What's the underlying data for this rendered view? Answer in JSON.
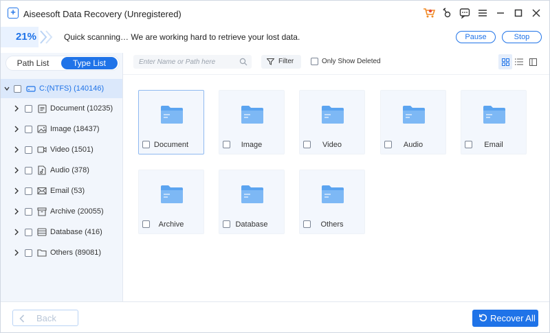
{
  "app": {
    "title": "Aiseesoft Data Recovery (Unregistered)"
  },
  "colors": {
    "accent": "#1f73e8",
    "selected_row": "#dbe8fb",
    "card_bg": "#f3f7fd",
    "folder": "#5ba4f0"
  },
  "progress": {
    "percent_label": "21%",
    "fraction": 0.21,
    "message": "Quick scanning… We are working hard to retrieve your lost data.",
    "pause_label": "Pause",
    "stop_label": "Stop"
  },
  "tabs": {
    "path_list": "Path List",
    "type_list": "Type List",
    "active": "type_list"
  },
  "tree": {
    "root": "C:(NTFS) (140146)",
    "items": [
      {
        "label": "Document (10235)",
        "icon": "document-icon"
      },
      {
        "label": "Image (18437)",
        "icon": "image-icon"
      },
      {
        "label": "Video (1501)",
        "icon": "video-icon"
      },
      {
        "label": "Audio (378)",
        "icon": "audio-icon"
      },
      {
        "label": "Email (53)",
        "icon": "email-icon"
      },
      {
        "label": "Archive (20055)",
        "icon": "archive-icon"
      },
      {
        "label": "Database (416)",
        "icon": "database-icon"
      },
      {
        "label": "Others (89081)",
        "icon": "others-icon"
      }
    ]
  },
  "toolbar": {
    "search_placeholder": "Enter Name or Path here",
    "filter_label": "Filter",
    "only_deleted_label": "Only Show Deleted",
    "view": "grid"
  },
  "grid": {
    "items": [
      "Document",
      "Image",
      "Video",
      "Audio",
      "Email",
      "Archive",
      "Database",
      "Others"
    ],
    "selected": "Document"
  },
  "footer": {
    "back_label": "Back",
    "recover_label": "Recover All"
  }
}
